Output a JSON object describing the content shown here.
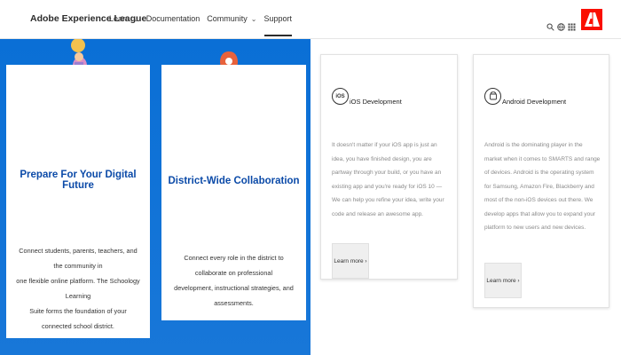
{
  "header": {
    "brand": "Adobe Experience League",
    "nav": [
      {
        "label": "Learn",
        "chevron": true
      },
      {
        "label": "Documentation",
        "chevron": false
      },
      {
        "label": "Community",
        "chevron": true
      },
      {
        "label": "Support",
        "chevron": false,
        "active": true
      }
    ],
    "icons": [
      "search-icon",
      "globe-icon",
      "apps-grid-icon",
      "adobe-logo"
    ],
    "logo_color": "#fa0f00"
  },
  "left_panel": {
    "background": "#1473e6",
    "cards": [
      {
        "title": "Prepare For Your Digital Future",
        "text_lines": [
          "Connect students, parents, teachers, and the community in",
          "one flexible online platform. The Schoology Learning",
          "Suite forms the foundation of your connected school district."
        ]
      },
      {
        "title": "District-Wide Collaboration",
        "text_lines": [
          "Connect every role in the district to collaborate on professional",
          "development, instructional strategies, and assessments."
        ]
      }
    ]
  },
  "dev_cards": [
    {
      "icon_text": "iOS",
      "title": "iOS Development",
      "text": "It doesn't matter if your iOS app is just an idea, you have finished design, you are partway through your build, or you have an existing app and you're ready for iOS 10 — We can help you refine your idea, write your code and release an awesome app.",
      "button": "Learn more ›"
    },
    {
      "icon_text": "",
      "title": "Android Development",
      "text": "Android is the dominating player in the market when it comes to SMARTS and range of devices. Android is the operating system for Samsung, Amazon Fire, Blackberry and most of the non-iOS devices out there. We develop apps that allow you to expand your platform to new users and new devices.",
      "button": "Learn more ›"
    }
  ]
}
